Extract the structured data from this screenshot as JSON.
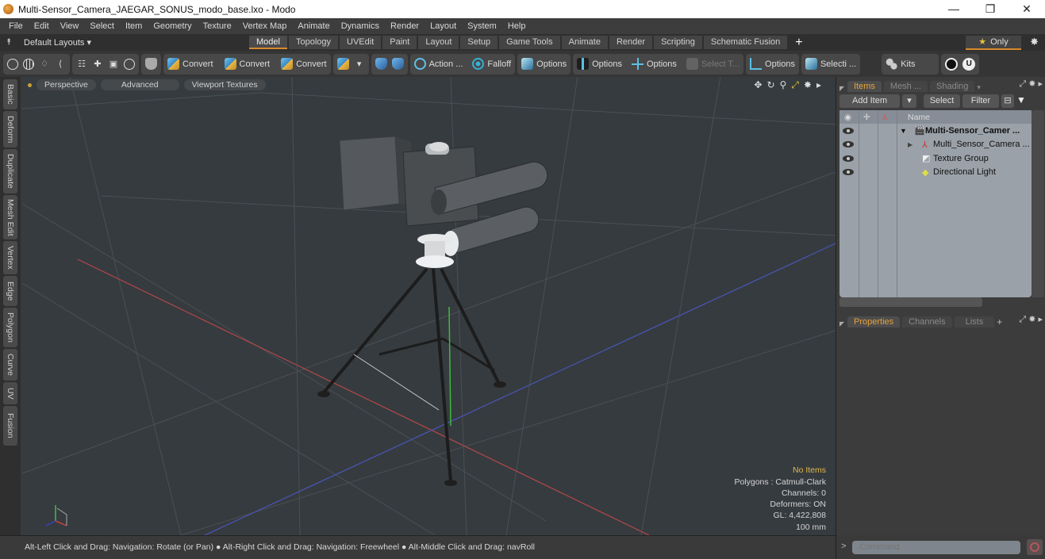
{
  "window": {
    "title": "Multi-Sensor_Camera_JAEGAR_SONUS_modo_base.lxo - Modo",
    "controls": [
      "—",
      "❐",
      "✕"
    ]
  },
  "menubar": [
    "File",
    "Edit",
    "View",
    "Select",
    "Item",
    "Geometry",
    "Texture",
    "Vertex Map",
    "Animate",
    "Dynamics",
    "Render",
    "Layout",
    "System",
    "Help"
  ],
  "layoutbar": {
    "layouts_label": "Default Layouts ▾",
    "tabs": [
      {
        "label": "Model",
        "active": true
      },
      {
        "label": "Topology"
      },
      {
        "label": "UVEdit"
      },
      {
        "label": "Paint"
      },
      {
        "label": "Layout"
      },
      {
        "label": "Setup"
      },
      {
        "label": "Game Tools"
      },
      {
        "label": "Animate"
      },
      {
        "label": "Render"
      },
      {
        "label": "Scripting"
      },
      {
        "label": "Schematic Fusion"
      }
    ],
    "add_tab": "+",
    "only_label": "Only"
  },
  "toolbar": {
    "convert1": "Convert",
    "convert2": "Convert",
    "convert3": "Convert",
    "action": "Action  ...",
    "falloff": "Falloff",
    "options1": "Options",
    "options2": "Options",
    "options3": "Options",
    "select_t": "Select T...",
    "options4": "Options",
    "selecti": "Selecti ...",
    "kits": "Kits"
  },
  "left_tabs": [
    "Basic",
    "Deform",
    "Duplicate",
    "Mesh Edit",
    "Vertex",
    "Edge",
    "Polygon",
    "Curve",
    "UV",
    "Fusion"
  ],
  "viewport": {
    "view_mode": "Perspective",
    "shading": "Advanced",
    "textures": "Viewport Textures",
    "info": {
      "selection": "No Items",
      "polygons": "Polygons : Catmull-Clark",
      "channels": "Channels: 0",
      "deformers": "Deformers: ON",
      "gl": "GL: 4,422,808",
      "unit": "100 mm"
    }
  },
  "status": {
    "hint": "Alt-Left Click and Drag: Navigation: Rotate (or Pan) ● Alt-Right Click and Drag: Navigation: Freewheel ● Alt-Middle Click and Drag: navRoll"
  },
  "items_panel": {
    "tabs": [
      {
        "label": "Items",
        "active": true
      },
      {
        "label": "Mesh ..."
      },
      {
        "label": "Shading"
      }
    ],
    "add_item": "Add Item",
    "select": "Select",
    "filter": "Filter",
    "column_name": "Name",
    "rows": [
      {
        "label": "Multi-Sensor_Camer ...",
        "bold": true,
        "depth": 0,
        "expander": "▼"
      },
      {
        "label": "Multi_Sensor_Camera ...",
        "depth": 1,
        "expander": "▶"
      },
      {
        "label": "Texture Group",
        "depth": 1
      },
      {
        "label": "Directional Light",
        "depth": 1
      }
    ]
  },
  "properties_panel": {
    "tabs": [
      {
        "label": "Properties",
        "active": true
      },
      {
        "label": "Channels"
      },
      {
        "label": "Lists"
      }
    ],
    "add": "+"
  },
  "command": {
    "placeholder": "Command",
    "prompt": ">"
  },
  "colors": {
    "accent": "#d88a2c",
    "active_tab_text": "#e5a23b",
    "viewport_bg": "#363b3f",
    "x_axis": "#c04040",
    "z_axis": "#4050c0",
    "y_axis": "#40c040"
  }
}
